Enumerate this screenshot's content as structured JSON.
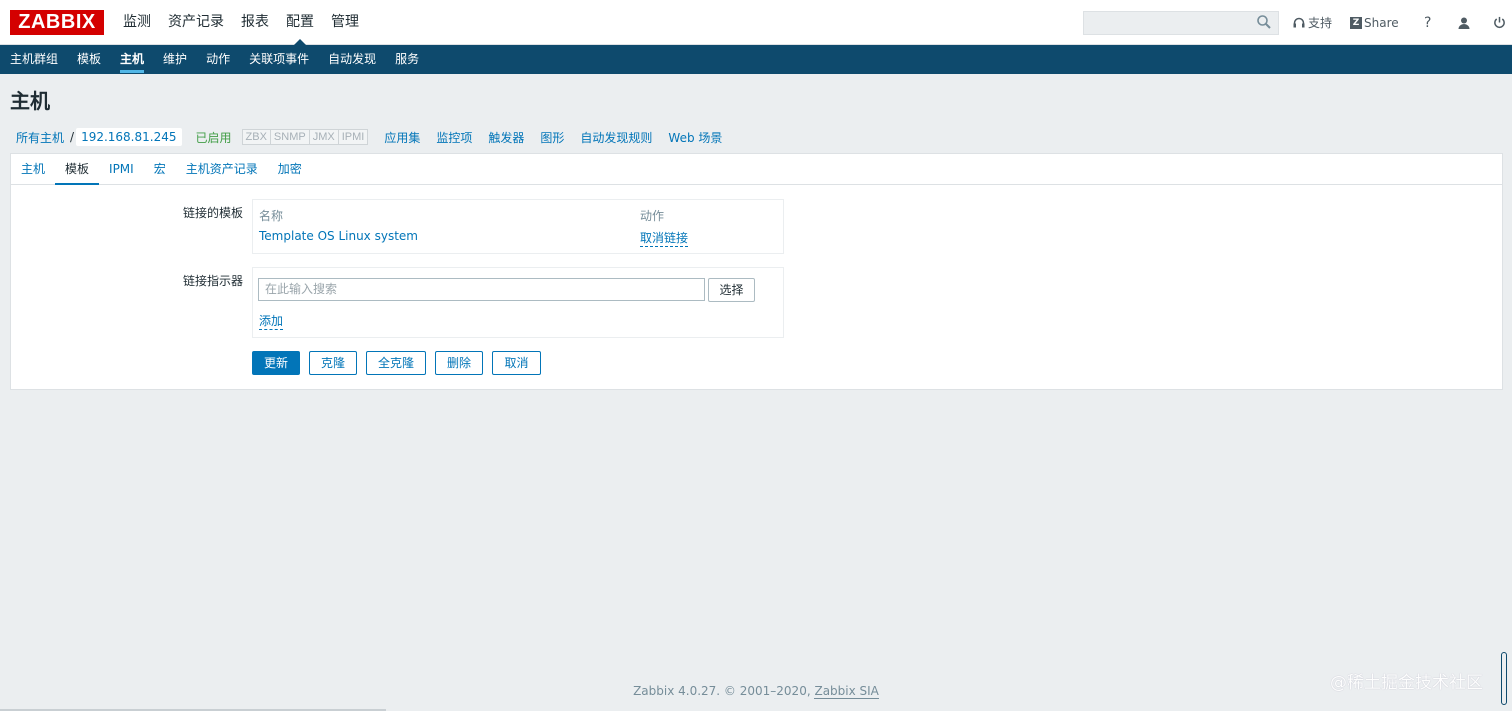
{
  "logo": "ZABBIX",
  "topnav": [
    "监测",
    "资产记录",
    "报表",
    "配置",
    "管理"
  ],
  "topbar": {
    "support": "支持",
    "share": "Share",
    "help": "?"
  },
  "subnav": [
    "主机群组",
    "模板",
    "主机",
    "维护",
    "动作",
    "关联项事件",
    "自动发现",
    "服务"
  ],
  "page_title": "主机",
  "breadcrumb": {
    "all_hosts": "所有主机",
    "sep": "/",
    "host": "192.168.81.245",
    "status": "已启用",
    "availability": [
      "ZBX",
      "SNMP",
      "JMX",
      "IPMI"
    ],
    "links": [
      "应用集",
      "监控项",
      "触发器",
      "图形",
      "自动发现规则",
      "Web 场景"
    ]
  },
  "tabs": [
    "主机",
    "模板",
    "IPMI",
    "宏",
    "主机资产记录",
    "加密"
  ],
  "form": {
    "linked_templates_label": "链接的模板",
    "col_name": "名称",
    "col_action": "动作",
    "template_name": "Template OS Linux system",
    "unlink": "取消链接",
    "link_new_label": "链接指示器",
    "search_placeholder": "在此输入搜索",
    "select_btn": "选择",
    "add": "添加",
    "buttons": {
      "update": "更新",
      "clone": "克隆",
      "full_clone": "全克隆",
      "delete": "删除",
      "cancel": "取消"
    }
  },
  "footer": {
    "text": "Zabbix 4.0.27. © 2001–2020,",
    "link": "Zabbix SIA"
  },
  "watermark": "@稀土掘金技术社区"
}
